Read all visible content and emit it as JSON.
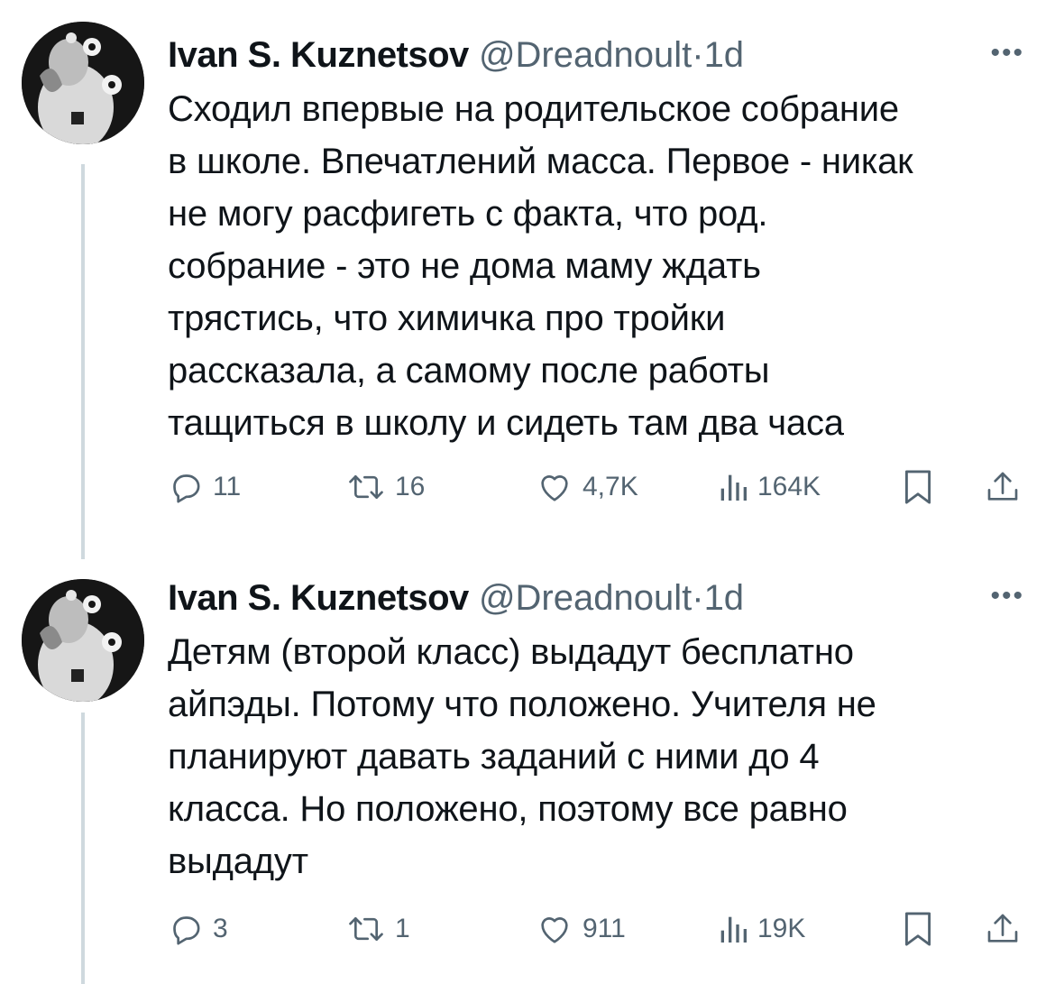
{
  "tweets": [
    {
      "author_name": "Ivan S. Kuznetsov",
      "handle": "@Dreadnoult",
      "separator": "·",
      "time": "1d",
      "more": "•••",
      "lines": [
        "Сходил впервые на родительское собрание",
        "в школе. Впечатлений масса. Первое - никак",
        "не могу расфигеть с факта, что род.",
        "собрание - это не дома маму ждать",
        "трястись, что химичка про тройки",
        "рассказала, а самому после работы",
        "тащиться в школу и сидеть там два часа"
      ],
      "replies": "11",
      "retweets": "16",
      "likes": "4,7K",
      "views": "164K"
    },
    {
      "author_name": "Ivan S. Kuznetsov",
      "handle": "@Dreadnoult",
      "separator": "·",
      "time": "1d",
      "more": "•••",
      "lines": [
        "Детям (второй класс) выдадут бесплатно",
        "айпэды. Потому что положено. Учителя не",
        "планируют давать заданий с ними до 4",
        "класса. Но положено, поэтому все равно",
        "выдадут"
      ],
      "replies": "3",
      "retweets": "1",
      "likes": "911",
      "views": "19K"
    }
  ],
  "icons": {
    "reply": "reply-icon",
    "retweet": "retweet-icon",
    "like": "heart-icon",
    "views": "views-bar-chart-icon",
    "bookmark": "bookmark-icon",
    "share": "share-icon"
  },
  "colors": {
    "text": "#0f1419",
    "secondary": "#536471",
    "thread_line": "#cfd9de"
  }
}
